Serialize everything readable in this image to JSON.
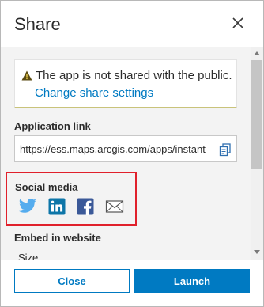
{
  "dialog": {
    "title": "Share",
    "close_icon": "close-icon"
  },
  "warning": {
    "icon": "warning-icon",
    "message": "The app is not shared with the public.",
    "link": "Change share settings"
  },
  "application_link": {
    "label": "Application link",
    "value": "https://ess.maps.arcgis.com/apps/instant",
    "copy_icon": "copy-icon"
  },
  "social_media": {
    "label": "Social media",
    "icons": [
      "twitter-icon",
      "linkedin-icon",
      "facebook-icon",
      "email-icon"
    ],
    "highlight_color": "#e0202b"
  },
  "embed": {
    "label": "Embed in website",
    "size_label": "Size"
  },
  "footer": {
    "close_label": "Close",
    "launch_label": "Launch"
  },
  "colors": {
    "accent": "#007ac2",
    "twitter": "#55acee",
    "linkedin": "#0e76a8",
    "facebook": "#3b5998"
  }
}
